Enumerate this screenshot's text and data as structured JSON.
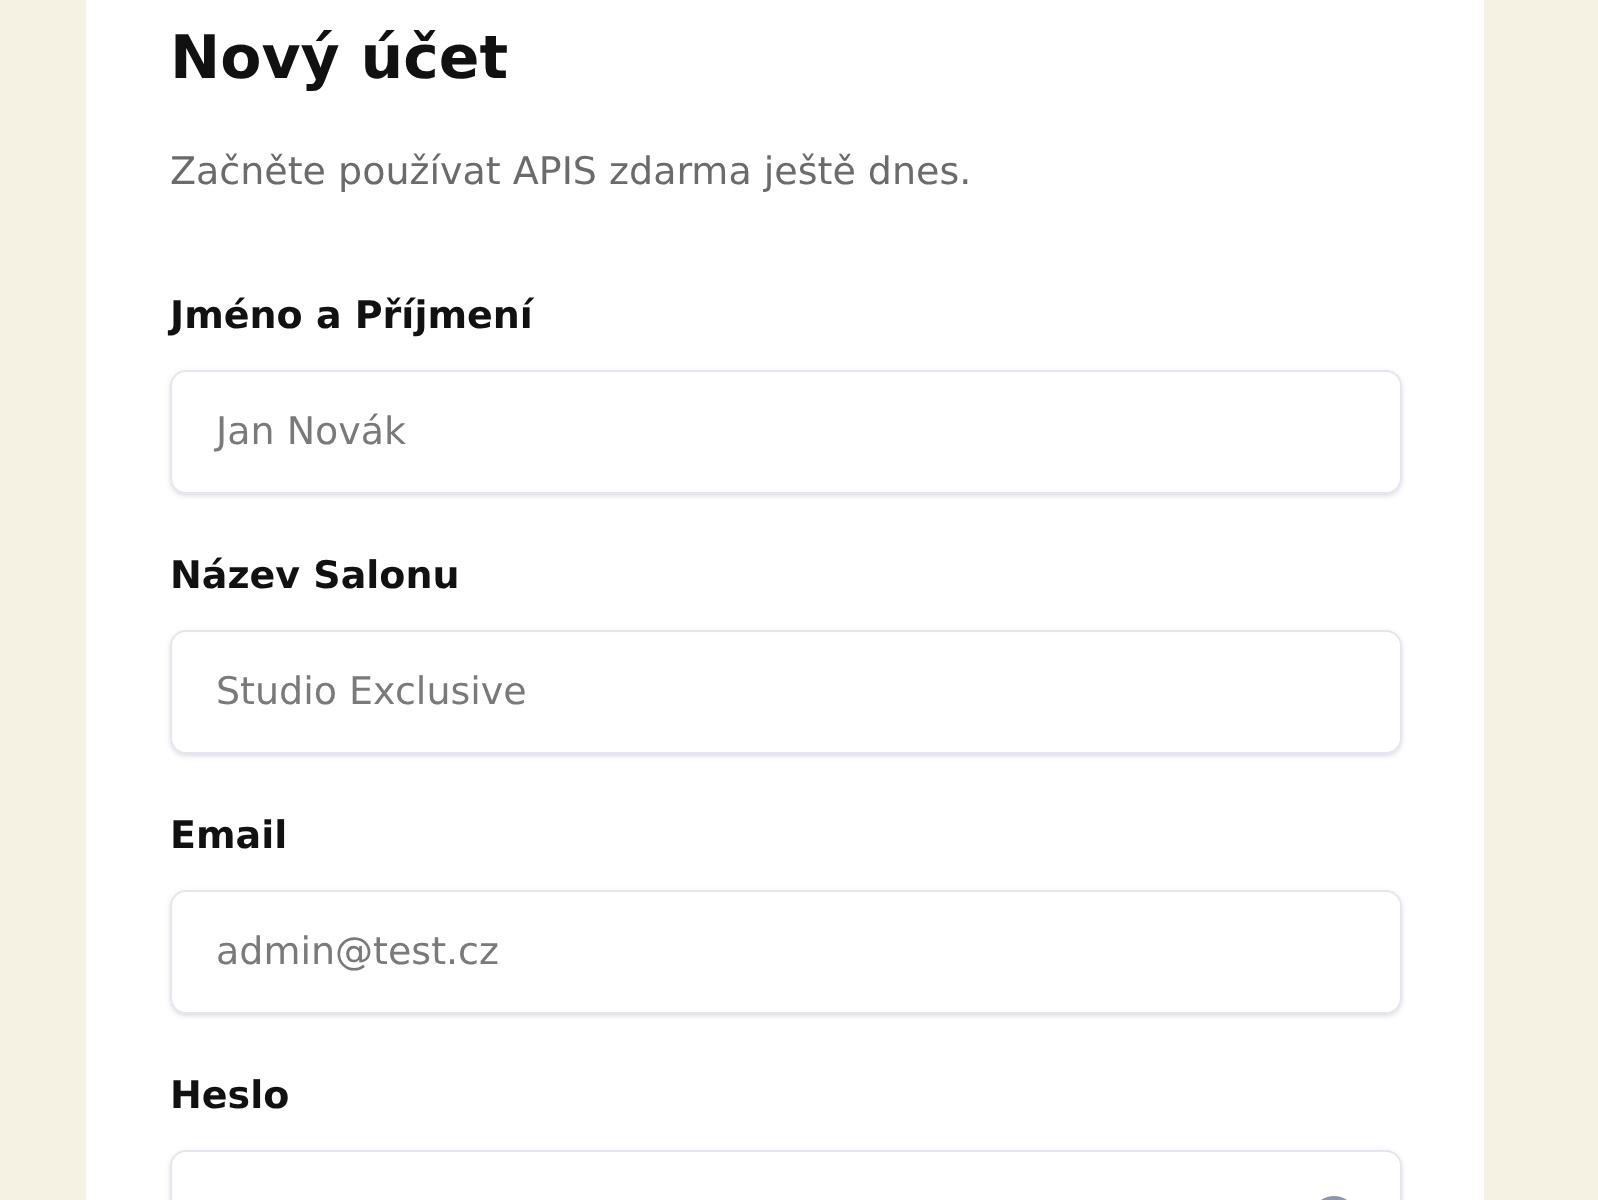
{
  "title": "Nový účet",
  "subtitle": "Začněte používat APIS zdarma ještě dnes.",
  "fields": [
    {
      "kind": "text",
      "label": "Jméno a Příjmení",
      "placeholder": "Jan Novák"
    },
    {
      "kind": "text",
      "label": "Název Salonu",
      "placeholder": "Studio Exclusive"
    },
    {
      "kind": "text",
      "label": "Email",
      "placeholder": "admin@test.cz"
    },
    {
      "kind": "password",
      "label": "Heslo"
    }
  ]
}
